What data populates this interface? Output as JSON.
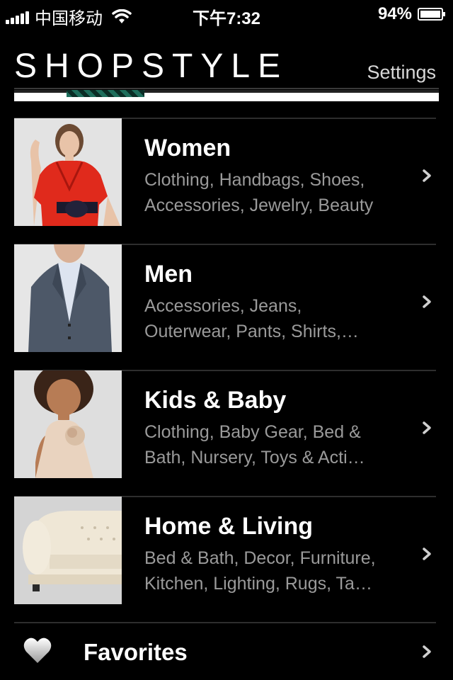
{
  "status_bar": {
    "carrier": "中国移动",
    "time": "下午7:32",
    "battery": "94%"
  },
  "header": {
    "logo": "SHOPSTYLE",
    "settings": "Settings"
  },
  "categories": [
    {
      "title": "Women",
      "subtitle_line1": "Clothing, Handbags, Shoes,",
      "subtitle_line2": "Accessories, Jewelry, Beauty"
    },
    {
      "title": "Men",
      "subtitle_line1": "Accessories, Jeans,",
      "subtitle_line2": "Outerwear, Pants, Shirts,…"
    },
    {
      "title": "Kids & Baby",
      "subtitle_line1": "Clothing, Baby Gear, Bed &",
      "subtitle_line2": "Bath, Nursery, Toys & Acti…"
    },
    {
      "title": "Home & Living",
      "subtitle_line1": "Bed & Bath, Decor, Furniture,",
      "subtitle_line2": "Kitchen, Lighting, Rugs, Ta…"
    }
  ],
  "favorites": {
    "label": "Favorites"
  },
  "icons": {
    "row_chevron": "chevron-right-icon",
    "favorites": "heart-icon"
  },
  "colors": {
    "background": "#000000",
    "title_text": "#ffffff",
    "subtitle_text": "#9a9a9a"
  }
}
